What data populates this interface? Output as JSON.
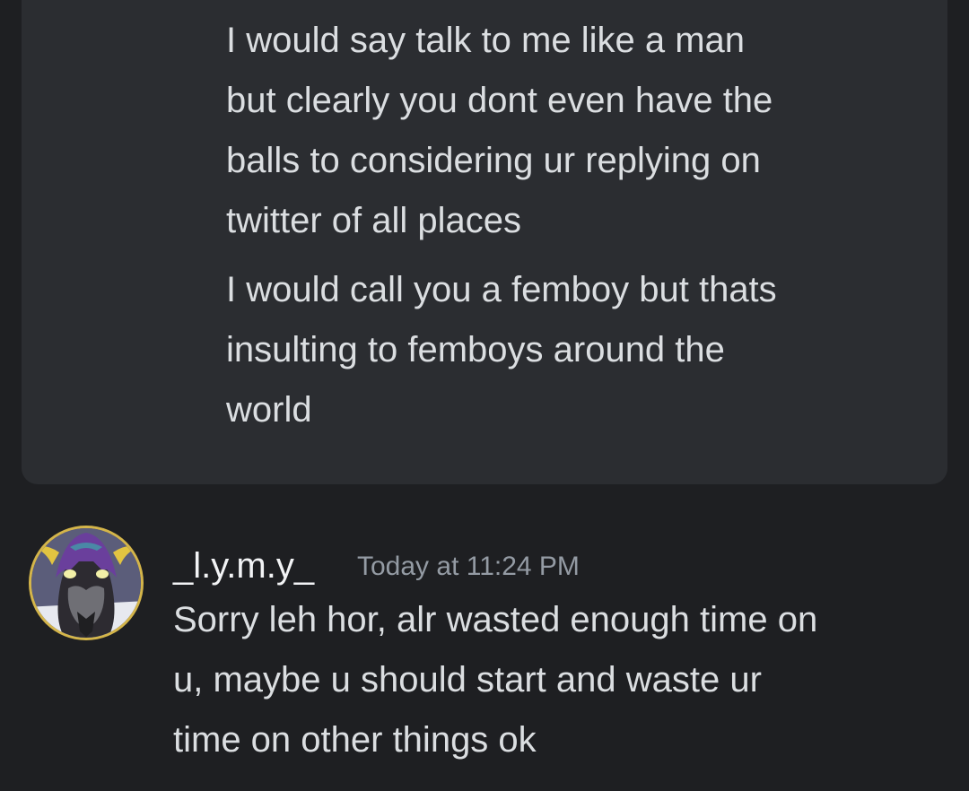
{
  "messages": {
    "previous": [
      {
        "text": "I would say talk to me like a man\nbut clearly you dont even have the\nballs to considering ur replying on\ntwitter of all places"
      },
      {
        "text": "I would call you a femboy but thats\ninsulting to femboys around the\nworld"
      }
    ],
    "reply": {
      "username": "_l.y.m.y_",
      "timestamp": "Today at 11:24 PM",
      "text": "Sorry leh hor, alr wasted enough time on\nu, maybe u should start and waste ur\ntime on other things ok",
      "avatar_icon": "cat-avatar-with-purple-horned-helmet"
    }
  },
  "colors": {
    "background": "#1e1f22",
    "highlight_block": "#2b2d31",
    "message_text": "#dbdee1",
    "username_text": "#f2f3f5",
    "timestamp_text": "#949ba4"
  }
}
